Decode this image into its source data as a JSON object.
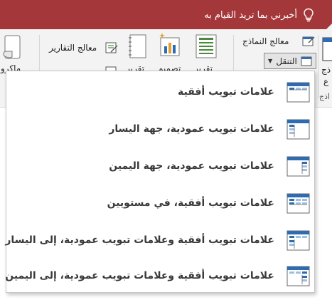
{
  "tell_me": {
    "text": "أخبرني بما تريد القيام به",
    "icon": "lightbulb-icon"
  },
  "ribbon": {
    "groups": [
      {
        "name": "forms",
        "wizard_label": "معالج النماذج",
        "navigation_label": "التنقل",
        "big_button_label_line1": "ذج",
        "big_button_label_line2": "ع",
        "group_label": "اذج"
      },
      {
        "name": "reports",
        "wizard_label": "معالج التقارير",
        "buttons": [
          {
            "label": "تقرير",
            "icon": "report-icon"
          },
          {
            "label": "تصميم",
            "icon": "report-design-icon"
          },
          {
            "label": "تقرير",
            "icon": "blank-report-icon"
          }
        ]
      },
      {
        "name": "macros",
        "label": "ماكرو",
        "icon": "macro-icon"
      }
    ]
  },
  "navigation_menu": {
    "items": [
      {
        "label": "علامات تبويب أفقية",
        "icon": "horizontal-tabs-icon"
      },
      {
        "label": "علامات تبويب عمودية، جهة اليسار",
        "icon": "vertical-tabs-left-icon"
      },
      {
        "label": "علامات تبويب عمودية، جهة اليمين",
        "icon": "vertical-tabs-right-icon"
      },
      {
        "label": "علامات تبويب أفقية، في مستويين",
        "icon": "horizontal-tabs-two-level-icon"
      },
      {
        "label": "علامات تبويب أفقية وعلامات تبويب عمودية، إلى اليسار",
        "icon": "horizontal-vertical-tabs-left-icon"
      },
      {
        "label": "علامات تبويب أفقية وعلامات تبويب عمودية، إلى اليمين",
        "icon": "horizontal-vertical-tabs-right-icon"
      }
    ]
  },
  "colors": {
    "title_bar": "#a4373a",
    "ribbon_bg": "#f3f3f3",
    "accent_blue": "#2e6bb0",
    "text": "#3a3a3a"
  }
}
